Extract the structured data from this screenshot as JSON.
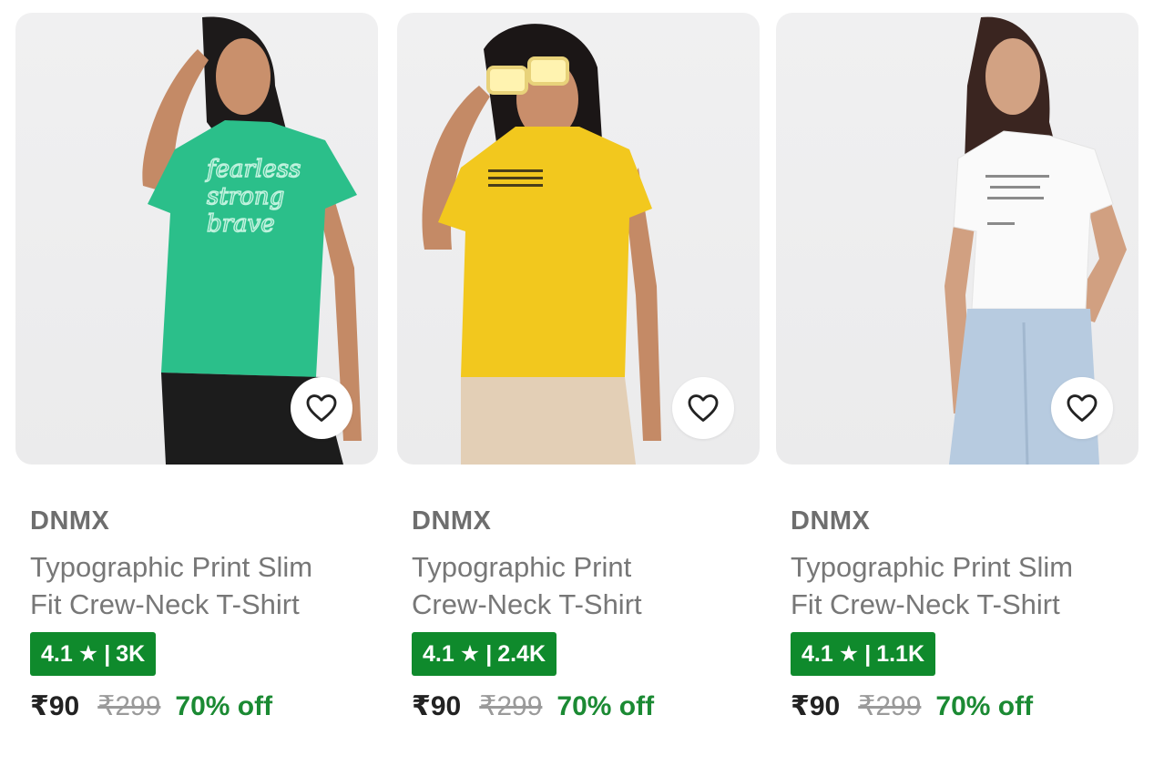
{
  "products": [
    {
      "brand": "DNMX",
      "title_line1": "Typographic Print Slim",
      "title_line2": "Fit Crew-Neck T-Shirt",
      "rating": "4.1",
      "rating_star": "★",
      "rating_sep": "|",
      "rating_count": "3K",
      "price": "₹90",
      "mrp": "₹299",
      "discount": "70% off",
      "shirt_color": "#2bbf8a",
      "wishlist_icon": "heart-outline-icon"
    },
    {
      "brand": "DNMX",
      "title_line1": "Typographic Print",
      "title_line2": "Crew-Neck T-Shirt",
      "rating": "4.1",
      "rating_star": "★",
      "rating_sep": "|",
      "rating_count": "2.4K",
      "price": "₹90",
      "mrp": "₹299",
      "discount": "70% off",
      "shirt_color": "#f2c81e",
      "wishlist_icon": "heart-outline-icon"
    },
    {
      "brand": "DNMX",
      "title_line1": "Typographic Print Slim",
      "title_line2": "Fit Crew-Neck T-Shirt",
      "rating": "4.1",
      "rating_star": "★",
      "rating_sep": "|",
      "rating_count": "1.1K",
      "price": "₹90",
      "mrp": "₹299",
      "discount": "70% off",
      "shirt_color": "#fafafa",
      "wishlist_icon": "heart-outline-icon"
    }
  ],
  "colors": {
    "rating_badge": "#0f8a2c",
    "discount_text": "#1b8a33",
    "brand_text": "#6e6e6e"
  }
}
